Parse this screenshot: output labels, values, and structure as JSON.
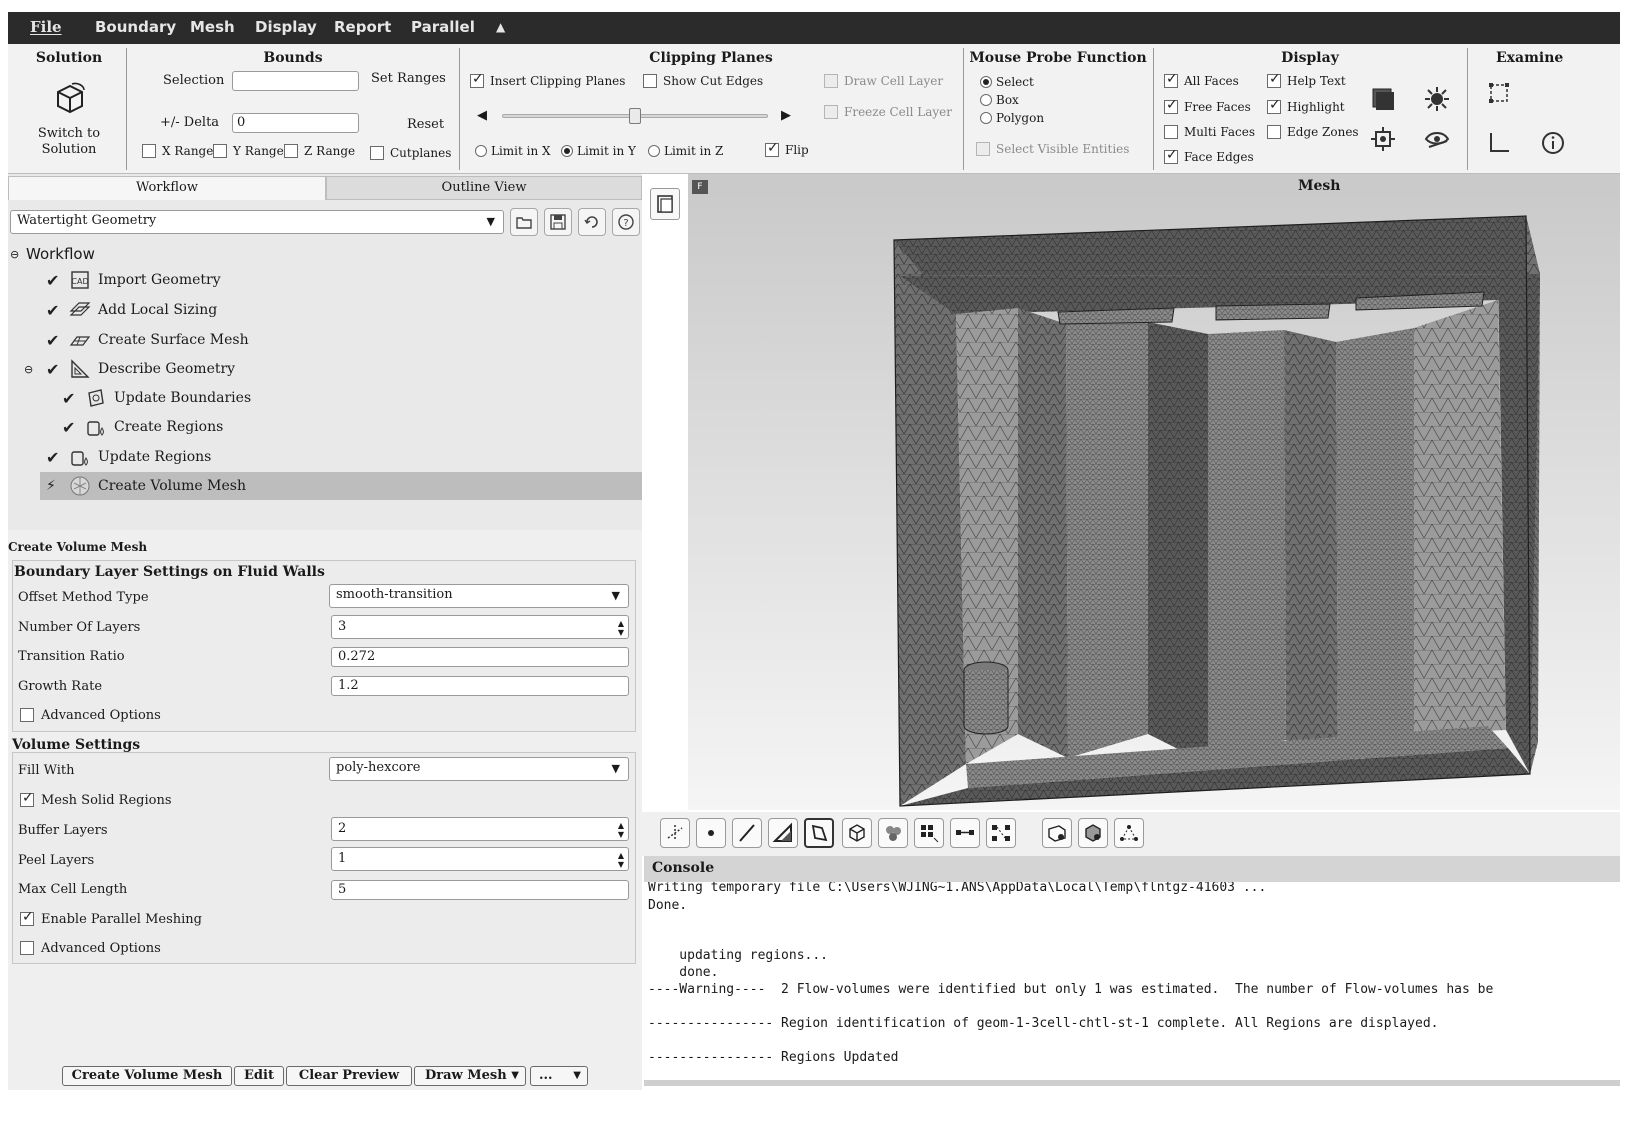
{
  "menubar": {
    "items": [
      "File",
      "Boundary",
      "Mesh",
      "Display",
      "Report",
      "Parallel"
    ]
  },
  "ribbon": {
    "solution": {
      "title": "Solution",
      "button_line1": "Switch to",
      "button_line2": "Solution"
    },
    "bounds": {
      "title": "Bounds",
      "selection_label": "Selection",
      "selection_value": "",
      "set_ranges": "Set Ranges",
      "delta_label": "+/- Delta",
      "delta_value": "0",
      "reset": "Reset",
      "x_range": "X Range",
      "y_range": "Y Range",
      "z_range": "Z Range",
      "cutplanes": "Cutplanes"
    },
    "clipping": {
      "title": "Clipping Planes",
      "insert": "Insert Clipping Planes",
      "show_cut_edges": "Show Cut Edges",
      "draw_cell_layer": "Draw Cell Layer",
      "freeze_cell_layer": "Freeze Cell Layer",
      "limit_x": "Limit in X",
      "limit_y": "Limit in Y",
      "limit_z": "Limit in Z",
      "flip": "Flip",
      "slider_position": 0.5
    },
    "probe": {
      "title": "Mouse Probe Function",
      "select": "Select",
      "box": "Box",
      "polygon": "Polygon",
      "select_visible": "Select Visible Entities"
    },
    "display": {
      "title": "Display",
      "all_faces": "All Faces",
      "free_faces": "Free Faces",
      "multi_faces": "Multi Faces",
      "face_edges": "Face Edges",
      "help_text": "Help Text",
      "highlight": "Highlight",
      "edge_zones": "Edge Zones"
    },
    "examine": {
      "title": "Examine"
    }
  },
  "left": {
    "tabs": [
      "Workflow",
      "Outline View"
    ],
    "workflow_type": "Watertight Geometry",
    "tree_root": "Workflow",
    "tree": [
      {
        "label": "Import Geometry"
      },
      {
        "label": "Add Local Sizing"
      },
      {
        "label": "Create Surface Mesh"
      },
      {
        "label": "Describe Geometry"
      },
      {
        "label": "Update Boundaries"
      },
      {
        "label": "Create Regions"
      },
      {
        "label": "Update Regions"
      },
      {
        "label": "Create Volume Mesh"
      }
    ],
    "task_title": "Create Volume Mesh",
    "bl": {
      "title": "Boundary Layer Settings on Fluid Walls",
      "offset_label": "Offset Method Type",
      "offset_value": "smooth-transition",
      "layers_label": "Number Of Layers",
      "layers_value": "3",
      "ratio_label": "Transition Ratio",
      "ratio_value": "0.272",
      "growth_label": "Growth Rate",
      "growth_value": "1.2",
      "advanced": "Advanced Options"
    },
    "vol": {
      "title": "Volume Settings",
      "fill_label": "Fill With",
      "fill_value": "poly-hexcore",
      "mesh_solid": "Mesh Solid Regions",
      "buffer_label": "Buffer Layers",
      "buffer_value": "2",
      "peel_label": "Peel Layers",
      "peel_value": "1",
      "maxcell_label": "Max Cell Length",
      "maxcell_value": "5",
      "parallel": "Enable Parallel Meshing",
      "advanced": "Advanced Options"
    },
    "buttons": {
      "create": "Create Volume Mesh",
      "edit": "Edit",
      "clear": "Clear Preview",
      "draw": "Draw Mesh",
      "more": "..."
    }
  },
  "graphics": {
    "badge": "F",
    "title": "Mesh"
  },
  "console": {
    "title": "Console",
    "lines": [
      "Writing temporary file C:\\Users\\WJING~1.ANS\\AppData\\Local\\Temp\\flntgz-41603 ...",
      "Done.",
      "",
      "",
      "    updating regions...",
      "    done.",
      "----Warning----  2 Flow-volumes were identified but only 1 was estimated.  The number of Flow-volumes has be",
      "",
      "---------------- Region identification of geom-1-3cell-chtl-st-1 complete. All Regions are displayed.",
      "",
      "---------------- Regions Updated"
    ]
  }
}
